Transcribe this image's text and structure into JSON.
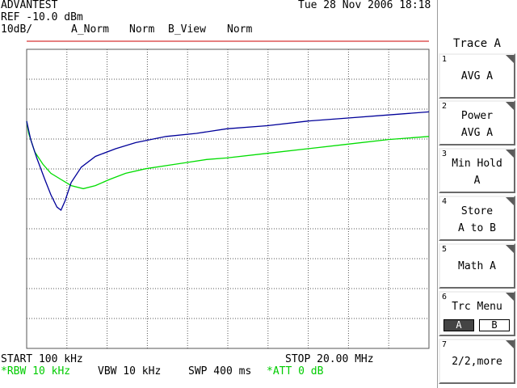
{
  "header": {
    "brand": "ADVANTEST",
    "datetime": "Tue 28 Nov 2006 18:18",
    "ref_level": "REF -10.0 dBm",
    "scale": "10dB/",
    "trace_a_mode": "A_Norm",
    "trace_a_detector": "Norm",
    "trace_b_mode": "B_View",
    "trace_b_detector": "Norm"
  },
  "footer": {
    "start": "START 100 kHz",
    "stop": "STOP 20.00 MHz",
    "rbw": "*RBW 10 kHz",
    "vbw": "VBW 10 kHz",
    "sweep": "SWP 400 ms",
    "att": "*ATT 0 dB"
  },
  "menu": {
    "title": "Trace A",
    "keys": [
      {
        "num": "1",
        "line1": "AVG A",
        "line2": ""
      },
      {
        "num": "2",
        "line1": "Power",
        "line2": "AVG A"
      },
      {
        "num": "3",
        "line1": "Min Hold",
        "line2": "A"
      },
      {
        "num": "4",
        "line1": "Store",
        "line2": "A to B"
      },
      {
        "num": "5",
        "line1": "Math A",
        "line2": ""
      },
      {
        "num": "6",
        "line1": "Trc Menu",
        "line2": ""
      },
      {
        "num": "7",
        "line1": "2/2,more",
        "line2": ""
      }
    ],
    "trc_select": {
      "a": "A",
      "b": "B",
      "selected": "A"
    }
  },
  "colors": {
    "trace_a": "#00dd00",
    "trace_b": "#000099",
    "ref_line": "#cc0000",
    "grid": "#555555"
  },
  "chart_data": {
    "type": "line",
    "x_unit": "MHz",
    "y_unit": "dBm",
    "xlim": [
      0.1,
      20.0
    ],
    "ylim": [
      -110,
      -10
    ],
    "grid": true,
    "series": [
      {
        "trace": "A",
        "x": [
          0.1,
          0.2,
          0.5,
          0.9,
          1.3,
          1.8,
          2.3,
          2.9,
          3.5,
          4.2,
          5.0,
          6.0,
          7.0,
          8.0,
          9.0,
          10.0,
          12.0,
          14.0,
          16.0,
          18.0,
          20.0
        ],
        "y": [
          -36,
          -40,
          -46,
          -50,
          -53,
          -55,
          -57,
          -58,
          -57,
          -55,
          -53,
          -51.5,
          -50.5,
          -49.5,
          -48.5,
          -48,
          -46.5,
          -45,
          -43.5,
          -42,
          -41
        ]
      },
      {
        "trace": "B",
        "x": [
          0.1,
          0.3,
          0.6,
          1.0,
          1.3,
          1.6,
          1.8,
          2.0,
          2.3,
          2.8,
          3.5,
          4.5,
          5.5,
          7.0,
          8.5,
          10.0,
          12.0,
          14.0,
          16.0,
          18.0,
          20.0
        ],
        "y": [
          -36,
          -42,
          -48,
          -55,
          -60,
          -64,
          -65,
          -62,
          -56,
          -51,
          -47.5,
          -45,
          -43,
          -41,
          -40,
          -38.5,
          -37.5,
          -36,
          -35,
          -34,
          -33
        ]
      }
    ]
  }
}
